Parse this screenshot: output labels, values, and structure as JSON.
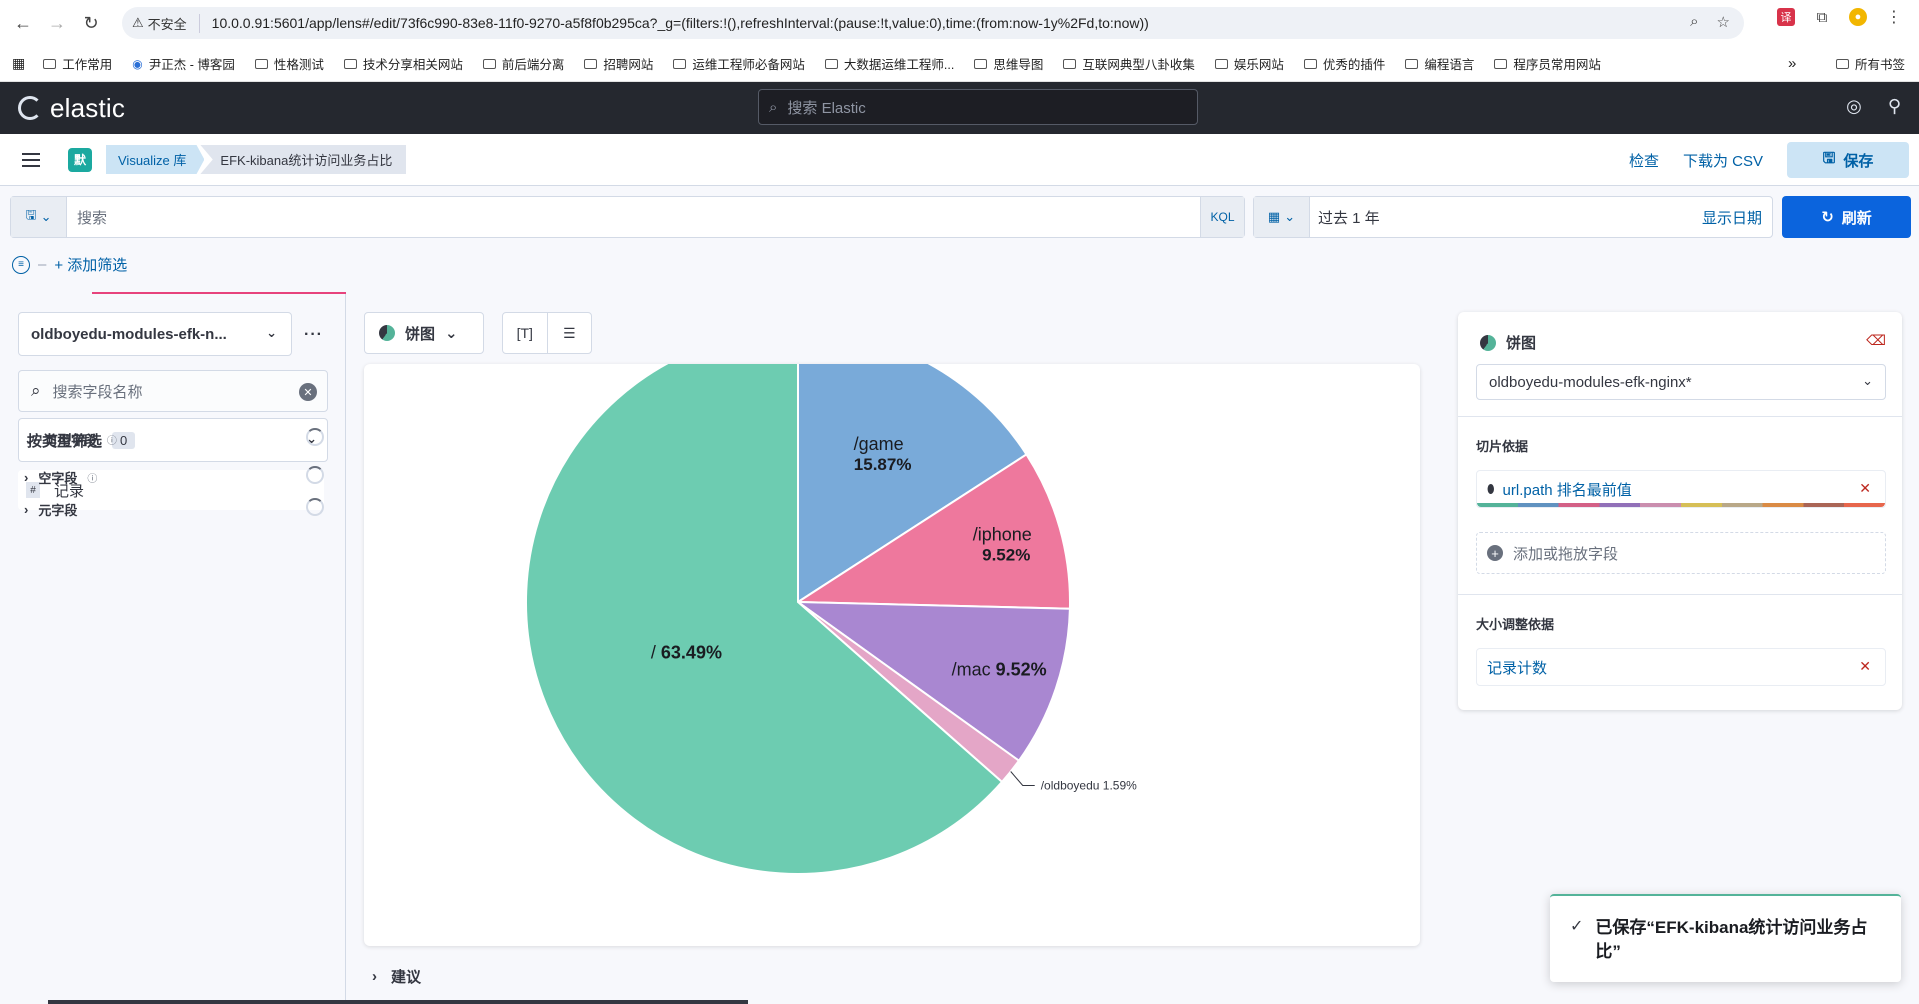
{
  "browser": {
    "insecure_label": "不安全",
    "url": "10.0.0.91:5601/app/lens#/edit/73f6c990-83e8-11f0-9270-a5f8f0b295ca?_g=(filters:!(),refreshInterval:(pause:!t,value:0),time:(from:now-1y%2Fd,to:now))",
    "bookmarks": [
      "工作常用",
      "尹正杰 - 博客园",
      "性格测试",
      "技术分享相关网站",
      "前后端分离",
      "招聘网站",
      "运维工程师必备网站",
      "大数据运维工程师...",
      "思维导图",
      "互联网典型八卦收集",
      "娱乐网站",
      "优秀的插件",
      "编程语言",
      "程序员常用网站"
    ],
    "bookmarks_more": "»",
    "all_bookmarks": "所有书签"
  },
  "header": {
    "logo": "elastic",
    "search_placeholder": "搜索 Elastic"
  },
  "breadcrumb": {
    "space": "默",
    "library": "Visualize 库",
    "current": "EFK-kibana统计访问业务占比",
    "inspect": "检查",
    "download_csv": "下载为 CSV",
    "save": "保存"
  },
  "query": {
    "placeholder": "搜索",
    "language": "KQL",
    "time_range": "过去 1 年",
    "show_dates": "显示日期",
    "refresh": "刷新",
    "add_filter": "+ 添加筛选"
  },
  "left": {
    "data_view": "oldboyedu-modules-efk-n...",
    "field_search_placeholder": "搜索字段名称",
    "type_filter_label": "按类型筛选",
    "type_filter_count": "0",
    "record_field": "记录",
    "sections": [
      "可用字段",
      "空字段",
      "元字段"
    ]
  },
  "center": {
    "chart_type": "饼图",
    "suggestions": "建议"
  },
  "right": {
    "title": "饼图",
    "data_view": "oldboyedu-modules-efk-nginx*",
    "slice_by_label": "切片依据",
    "slice_by_value": "url.path 排名最前值",
    "add_field": "添加或拖放字段",
    "size_by_label": "大小调整依据",
    "size_by_value": "记录计数"
  },
  "toast": {
    "message": "已保存“EFK-kibana统计访问业务占比”"
  },
  "colors": {
    "slice_root": "#6dccb1",
    "slice_game": "#79aad9",
    "slice_iphone": "#ee789d",
    "slice_mac": "#a987d1",
    "slice_oldboyedu": "#e4a6c7",
    "accent": "#0b64dd"
  },
  "chart_data": {
    "type": "pie",
    "slices": [
      {
        "label": "/game",
        "percent": 15.87,
        "display": "15.87%",
        "color": "#79aad9"
      },
      {
        "label": "/iphone",
        "percent": 9.52,
        "display": "9.52%",
        "color": "#ee789d"
      },
      {
        "label": "/mac",
        "percent": 9.52,
        "display": "9.52%",
        "color": "#a987d1"
      },
      {
        "label": "/oldboyedu",
        "percent": 1.59,
        "display": "1.59%",
        "color": "#e4a6c7"
      },
      {
        "label": "/",
        "percent": 63.49,
        "display": "63.49%",
        "color": "#6dccb1"
      }
    ]
  }
}
